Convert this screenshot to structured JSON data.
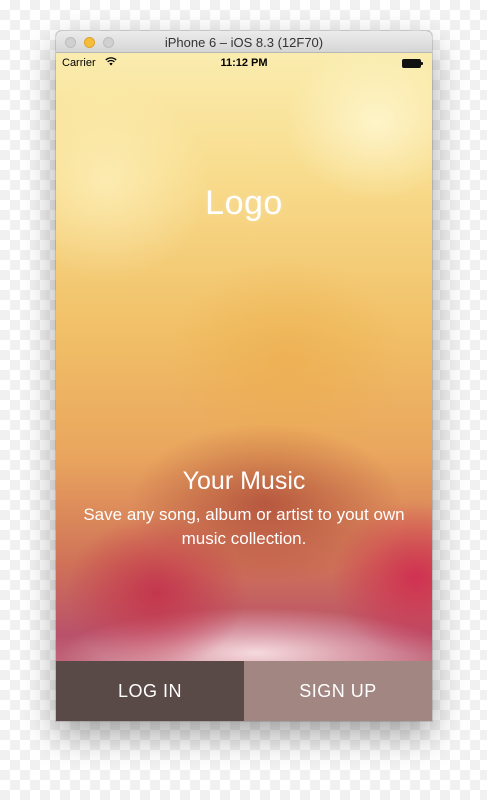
{
  "window": {
    "title": "iPhone 6 – iOS 8.3 (12F70)"
  },
  "status_bar": {
    "carrier": "Carrier",
    "time": "11:12 PM",
    "wifi_icon": "wifi-icon",
    "battery_icon": "battery-icon"
  },
  "main": {
    "logo": "Logo",
    "headline": "Your Music",
    "subtitle": "Save any song, album or artist to yout own music collection."
  },
  "buttons": {
    "login_label": "LOG IN",
    "signup_label": "SIGN UP"
  },
  "colors": {
    "login_bg": "#5a4a47",
    "signup_bg": "#a28682"
  }
}
